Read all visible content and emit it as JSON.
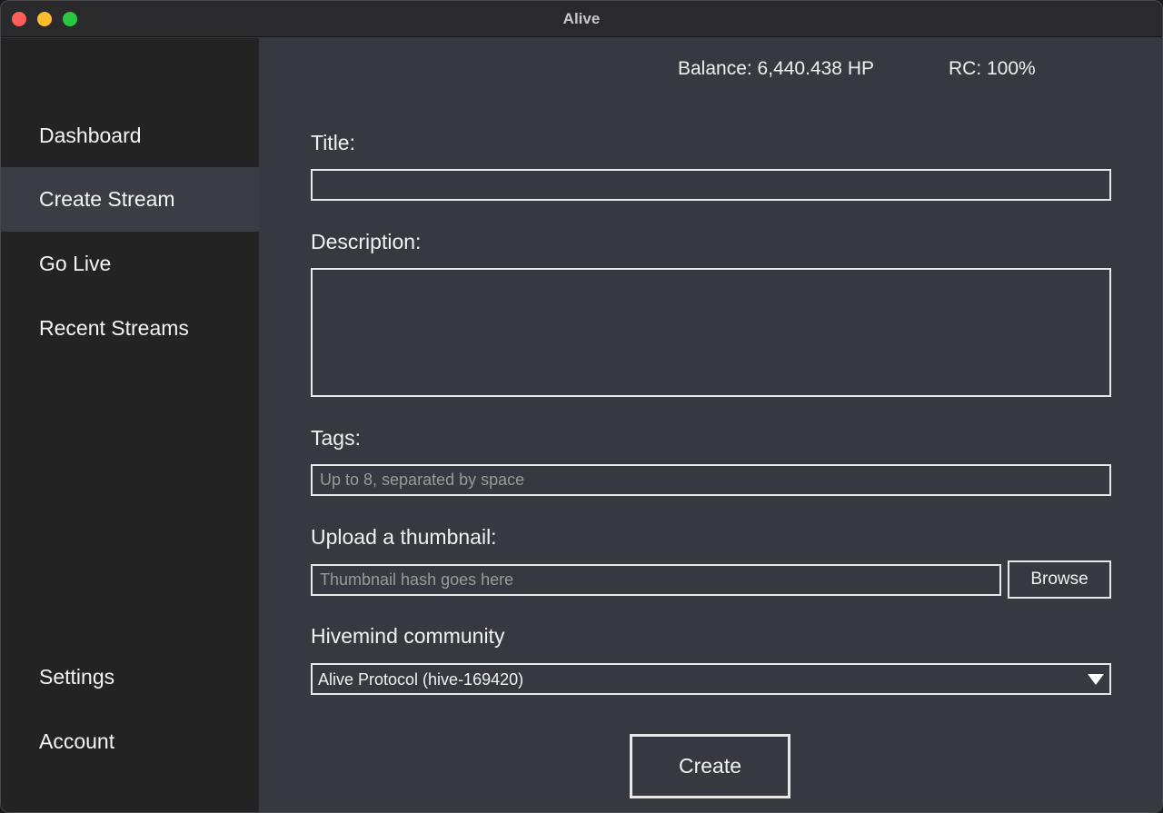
{
  "window": {
    "title": "Alive",
    "colors": {
      "close": "#ff5f57",
      "minimize": "#febc2e",
      "maximize": "#28c840"
    }
  },
  "sidebar": {
    "items": [
      {
        "label": "Dashboard",
        "active": false
      },
      {
        "label": "Create Stream",
        "active": true
      },
      {
        "label": "Go Live",
        "active": false
      },
      {
        "label": "Recent Streams",
        "active": false
      }
    ],
    "bottom_items": [
      {
        "label": "Settings"
      },
      {
        "label": "Account"
      }
    ]
  },
  "header": {
    "balance": "Balance: 6,440.438 HP",
    "rc": "RC: 100%"
  },
  "form": {
    "title_label": "Title:",
    "title_value": "",
    "description_label": "Description:",
    "description_value": "",
    "tags_label": "Tags:",
    "tags_value": "",
    "tags_placeholder": "Up to 8, separated by space",
    "thumbnail_label": "Upload a thumbnail:",
    "thumbnail_value": "",
    "thumbnail_placeholder": "Thumbnail hash goes here",
    "browse_label": "Browse",
    "community_label": "Hivemind community",
    "community_selected": "Alive Protocol (hive-169420)",
    "create_label": "Create"
  },
  "icons": {
    "dropdown": "chevron-down-icon"
  }
}
